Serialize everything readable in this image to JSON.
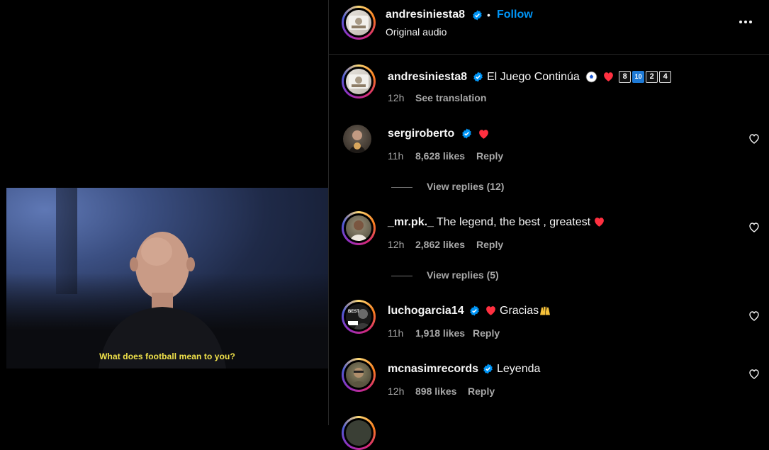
{
  "video": {
    "subtitle": "What does football mean to you?"
  },
  "header": {
    "username": "andresiniesta8",
    "separator": "•",
    "follow_label": "Follow",
    "audio_label": "Original audio"
  },
  "caption": {
    "username": "andresiniesta8",
    "text": "El Juego Continúa",
    "keycaps": [
      "8",
      "10",
      "2",
      "4"
    ],
    "time": "12h",
    "see_translation": "See translation"
  },
  "comments": [
    {
      "username": "sergiroberto",
      "text": "",
      "time": "11h",
      "likes": "8,628 likes",
      "reply_label": "Reply",
      "view_replies": "View replies (12)"
    },
    {
      "username": "_mr.pk._",
      "text": "The legend, the best , greatest",
      "time": "12h",
      "likes": "2,862 likes",
      "reply_label": "Reply",
      "view_replies": "View replies (5)"
    },
    {
      "username": "luchogarcia14",
      "text": "Gracias",
      "time": "11h",
      "likes": "1,918 likes",
      "reply_label": "Reply"
    },
    {
      "username": "mcnasimrecords",
      "text": "Leyenda",
      "time": "12h",
      "likes": "898 likes",
      "reply_label": "Reply"
    }
  ],
  "colors": {
    "accent_blue": "#0095f6",
    "secondary_text": "#a8a8a8",
    "heart_red": "#ff3040",
    "subtitle_yellow": "#f1e24a"
  }
}
